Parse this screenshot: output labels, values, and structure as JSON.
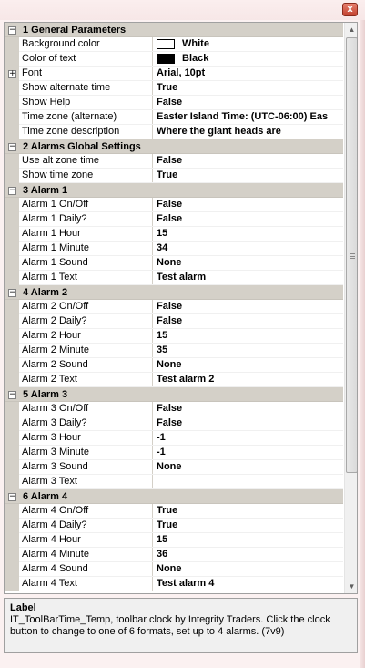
{
  "window": {
    "close_label": "x"
  },
  "grid": {
    "categories": [
      {
        "label": "1 General Parameters",
        "rows": [
          {
            "name": "Background color",
            "value": "White",
            "swatch": "#ffffff"
          },
          {
            "name": "Color of text",
            "value": "Black",
            "swatch": "#000000"
          },
          {
            "name": "Font",
            "value": "Arial, 10pt",
            "expandable": true
          },
          {
            "name": "Show alternate time",
            "value": "True"
          },
          {
            "name": "Show Help",
            "value": "False"
          },
          {
            "name": "Time zone (alternate)",
            "value": "Easter Island Time: (UTC-06:00) Eas"
          },
          {
            "name": "Time zone description",
            "value": "Where the giant heads are"
          }
        ]
      },
      {
        "label": "2 Alarms Global Settings",
        "rows": [
          {
            "name": "Use alt zone time",
            "value": "False"
          },
          {
            "name": "Show time zone",
            "value": "True"
          }
        ]
      },
      {
        "label": "3 Alarm 1",
        "rows": [
          {
            "name": "Alarm 1 On/Off",
            "value": "False"
          },
          {
            "name": "Alarm 1 Daily?",
            "value": "False"
          },
          {
            "name": "Alarm 1 Hour",
            "value": "15"
          },
          {
            "name": "Alarm 1 Minute",
            "value": "34"
          },
          {
            "name": "Alarm 1 Sound",
            "value": "None"
          },
          {
            "name": "Alarm 1 Text",
            "value": "Test alarm"
          }
        ]
      },
      {
        "label": "4 Alarm 2",
        "rows": [
          {
            "name": "Alarm 2 On/Off",
            "value": "False"
          },
          {
            "name": "Alarm 2 Daily?",
            "value": "False"
          },
          {
            "name": "Alarm 2 Hour",
            "value": "15"
          },
          {
            "name": "Alarm 2 Minute",
            "value": "35"
          },
          {
            "name": "Alarm 2 Sound",
            "value": "None"
          },
          {
            "name": "Alarm 2 Text",
            "value": "Test alarm 2"
          }
        ]
      },
      {
        "label": "5 Alarm 3",
        "rows": [
          {
            "name": "Alarm 3 On/Off",
            "value": "False"
          },
          {
            "name": "Alarm 3 Daily?",
            "value": "False"
          },
          {
            "name": "Alarm 3 Hour",
            "value": "-1"
          },
          {
            "name": "Alarm 3 Minute",
            "value": "-1"
          },
          {
            "name": "Alarm 3 Sound",
            "value": "None"
          },
          {
            "name": "Alarm 3 Text",
            "value": ""
          }
        ]
      },
      {
        "label": "6 Alarm 4",
        "rows": [
          {
            "name": "Alarm 4 On/Off",
            "value": "True"
          },
          {
            "name": "Alarm 4 Daily?",
            "value": "True"
          },
          {
            "name": "Alarm 4 Hour",
            "value": "15"
          },
          {
            "name": "Alarm 4 Minute",
            "value": "36"
          },
          {
            "name": "Alarm 4 Sound",
            "value": "None"
          },
          {
            "name": "Alarm 4 Text",
            "value": "Test alarm 4"
          }
        ]
      }
    ]
  },
  "help": {
    "title": "Label",
    "description": "IT_ToolBarTime_Temp, toolbar clock by Integrity Traders. Click the clock button to change to one of 6 formats, set up to 4 alarms. (7v9)"
  }
}
